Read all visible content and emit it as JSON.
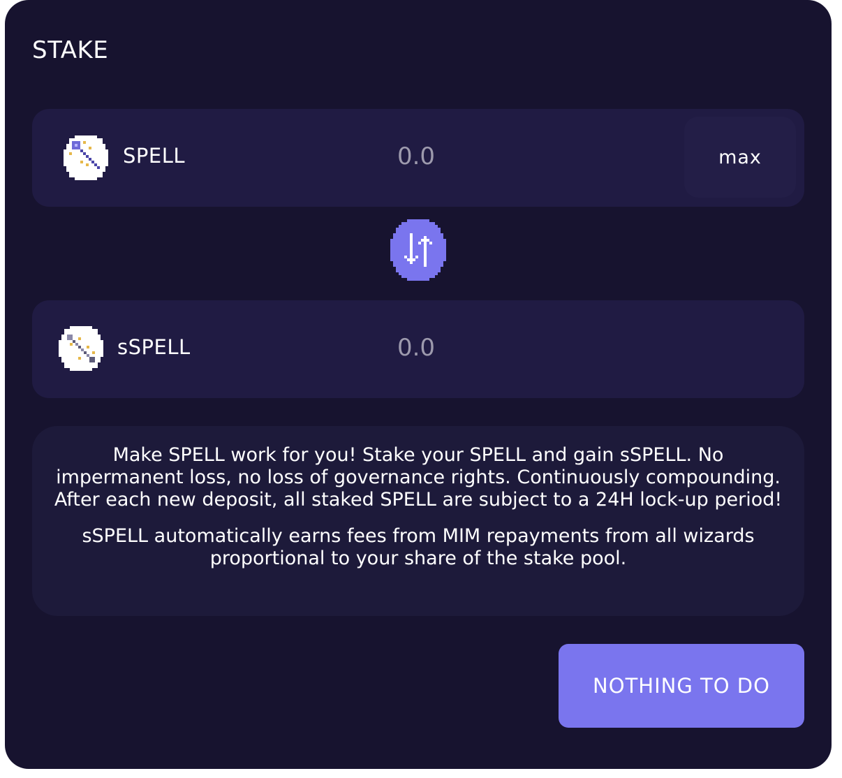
{
  "card": {
    "title": "STAKE"
  },
  "from_token": {
    "symbol": "SPELL",
    "icon": "magic-wand-icon",
    "amount_placeholder": "0.0",
    "max_label": "max"
  },
  "swap": {
    "icon": "swap-arrows-icon"
  },
  "to_token": {
    "symbol": "sSPELL",
    "icon": "magic-staff-icon",
    "amount_placeholder": "0.0"
  },
  "info": {
    "paragraph_1": "Make SPELL work for you! Stake your SPELL and gain sSPELL. No impermanent loss, no loss of governance rights. Continuously compounding. After each new deposit, all staked SPELL are subject to a 24H lock-up period!",
    "paragraph_2": "sSPELL automatically earns fees from MIM repayments from all wizards proportional to your share of the stake pool."
  },
  "action": {
    "label": "NOTHING TO DO"
  },
  "colors": {
    "card_bg": "#17132f",
    "row_bg": "#201b43",
    "accent": "#7a75ee",
    "muted_text": "#9d9aad"
  }
}
